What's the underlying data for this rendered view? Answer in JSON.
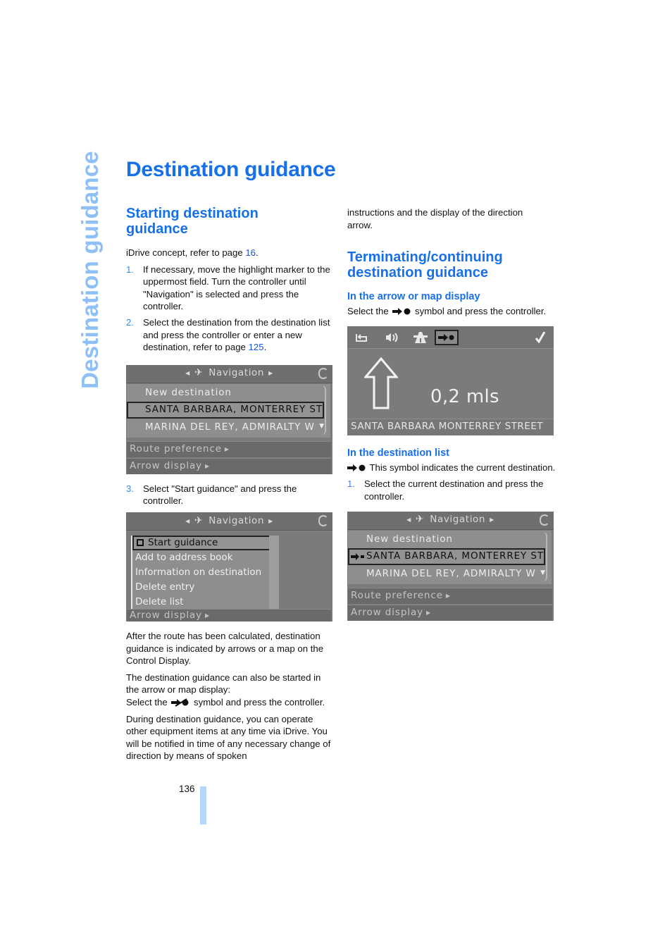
{
  "side_tab": {
    "label": "Destination guidance"
  },
  "page_title": "Destination guidance",
  "left": {
    "heading": "Starting destination guidance",
    "intro_prefix": "iDrive concept, refer to page ",
    "intro_link": "16",
    "intro_suffix": ".",
    "steps": [
      {
        "num": "1.",
        "text": "If necessary, move the highlight marker to the uppermost field. Turn the controller until \"Navigation\" is selected and press the controller."
      },
      {
        "num": "2.",
        "text_prefix": "Select the destination from the destination list and press the controller or enter a new destination, refer to page ",
        "link": "125",
        "text_suffix": "."
      }
    ],
    "screen1": {
      "header": "Navigation",
      "rows": [
        "New destination",
        "SANTA BARBARA, MONTERREY ST",
        "MARINA DEL REY, ADMIRALTY W"
      ],
      "selected_row": 1,
      "bars": [
        "Route preference",
        "Arrow display"
      ]
    },
    "step3": {
      "num": "3.",
      "text": "Select \"Start guidance\" and press the controller."
    },
    "screen2": {
      "header": "Navigation",
      "menu": [
        "Start guidance",
        "Add to address book",
        "Information on destination",
        "Delete entry",
        "Delete list"
      ],
      "bar": "Arrow display"
    },
    "para1": "After the route has been calculated, destination guidance is indicated by arrows or a map on the Control Display.",
    "para2a": "The destination guidance can also be started in the arrow or map display:",
    "para2b_prefix": "Select the",
    "para2b_suffix": "symbol and press the controller.",
    "para3": "During destination guidance, you can operate other equipment items at any time via iDrive. You will be notified in time of any necessary change of direction by means of spoken"
  },
  "right": {
    "cont": "instructions and the display of the direction arrow.",
    "heading": "Terminating/continuing destination guidance",
    "sub1": "In the arrow or map display",
    "sub1_prefix": "Select the",
    "sub1_suffix": "symbol and press the controller.",
    "arrow_screen": {
      "toolbar_icons": [
        "return-icon",
        "voice-icon",
        "road-icon",
        "destination-guidance-icon",
        "check-icon"
      ],
      "selected_icon": 3,
      "distance": "0,2 mls",
      "street": "SANTA BARBARA MONTERREY STREET"
    },
    "sub2": "In the destination list",
    "sub2_text": "This symbol indicates the current destination.",
    "steps": [
      {
        "num": "1.",
        "text": "Select the current destination and press the controller."
      }
    ],
    "screen3": {
      "header": "Navigation",
      "rows": [
        "New destination",
        "SANTA BARBARA, MONTERREY ST",
        "MARINA DEL REY, ADMIRALTY W"
      ],
      "selected_row": 1,
      "bars": [
        "Route preference",
        "Arrow display"
      ]
    }
  },
  "page_number": "136",
  "colors": {
    "accent": "#1770e8",
    "side_tab": "#8ec0f7",
    "page_bar": "#b7d6fb",
    "screen_bg": "#7b7b7b"
  }
}
